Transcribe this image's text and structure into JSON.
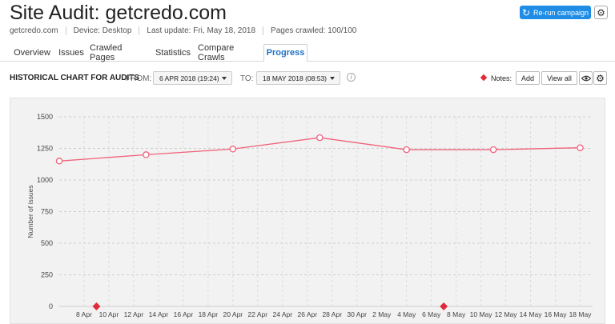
{
  "header": {
    "title": "Site Audit: getcredo.com",
    "meta": [
      "getcredo.com",
      "Device: Desktop",
      "Last update: Fri, May 18, 2018",
      "Pages crawled: 100/100"
    ],
    "rerun_label": "Re-run campaign"
  },
  "tabs": [
    {
      "label": "Overview",
      "active": false
    },
    {
      "label": "Issues",
      "active": false
    },
    {
      "label": "Crawled Pages",
      "active": false
    },
    {
      "label": "Statistics",
      "active": false
    },
    {
      "label": "Compare Crawls",
      "active": false
    },
    {
      "label": "Progress",
      "active": true
    }
  ],
  "filter": {
    "title": "HISTORICAL CHART FOR AUDITS",
    "from_label": "FROM:",
    "from_value": "6 APR 2018 (19:24)",
    "to_label": "TO:",
    "to_value": "18 MAY 2018 (08:53)",
    "info_glyph": "i",
    "notes_label": "Notes:",
    "add_label": "Add",
    "view_all_label": "View all"
  },
  "colors": {
    "accent": "#1f8ce6",
    "series": "#f0627a",
    "note_marker": "#e02b38"
  },
  "chart_data": {
    "type": "line",
    "ylabel": "Number of issues",
    "ylim": [
      0,
      1500
    ],
    "yticks": [
      0,
      250,
      500,
      750,
      1000,
      1250,
      1500
    ],
    "xlim": [
      "2018-04-06",
      "2018-05-19"
    ],
    "xticks": [
      "8 Apr",
      "10 Apr",
      "12 Apr",
      "14 Apr",
      "16 Apr",
      "18 Apr",
      "20 Apr",
      "22 Apr",
      "24 Apr",
      "26 Apr",
      "28 Apr",
      "30 Apr",
      "2 May",
      "4 May",
      "6 May",
      "8 May",
      "10 May",
      "12 May",
      "14 May",
      "16 May",
      "18 May"
    ],
    "xtick_dates": [
      "2018-04-08",
      "2018-04-10",
      "2018-04-12",
      "2018-04-14",
      "2018-04-16",
      "2018-04-18",
      "2018-04-20",
      "2018-04-22",
      "2018-04-24",
      "2018-04-26",
      "2018-04-28",
      "2018-04-30",
      "2018-05-02",
      "2018-05-04",
      "2018-05-06",
      "2018-05-08",
      "2018-05-10",
      "2018-05-12",
      "2018-05-14",
      "2018-05-16",
      "2018-05-18"
    ],
    "points": [
      {
        "date": "2018-04-06",
        "value": 1150
      },
      {
        "date": "2018-04-13",
        "value": 1200
      },
      {
        "date": "2018-04-20",
        "value": 1245
      },
      {
        "date": "2018-04-27",
        "value": 1335
      },
      {
        "date": "2018-05-04",
        "value": 1240
      },
      {
        "date": "2018-05-11",
        "value": 1240
      },
      {
        "date": "2018-05-18",
        "value": 1255
      }
    ],
    "notes": [
      "2018-04-09",
      "2018-05-07"
    ],
    "grid": true
  }
}
